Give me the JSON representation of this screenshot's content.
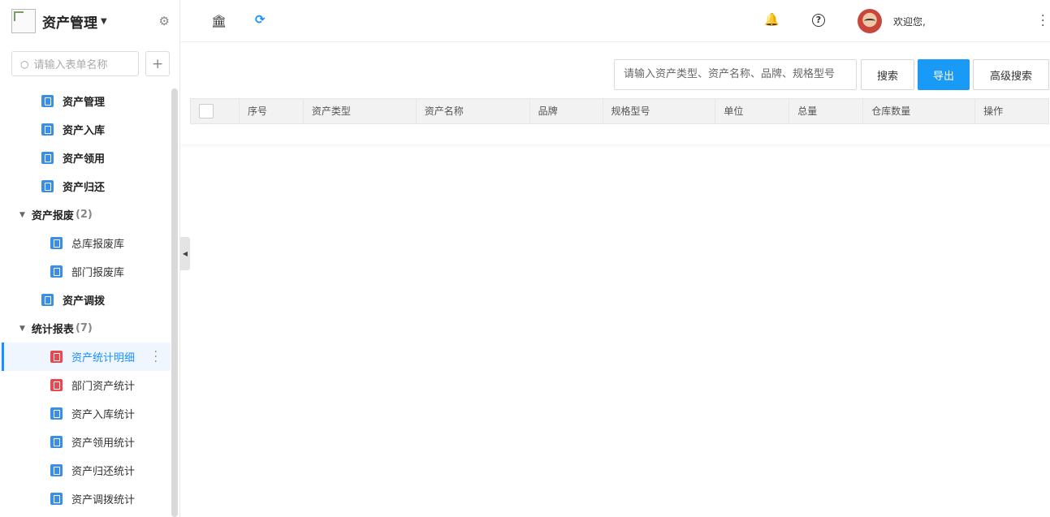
{
  "sidebar": {
    "app_title": "资产管理",
    "search_placeholder": "请输入表单名称",
    "items": [
      {
        "label": "资产管理",
        "type": "item",
        "color": "blue"
      },
      {
        "label": "资产入库",
        "type": "item",
        "color": "blue"
      },
      {
        "label": "资产领用",
        "type": "item",
        "color": "blue"
      },
      {
        "label": "资产归还",
        "type": "item",
        "color": "blue"
      },
      {
        "label": "资产报废",
        "type": "group",
        "count": "(2)"
      },
      {
        "label": "总库报废库",
        "type": "child",
        "color": "blue"
      },
      {
        "label": "部门报废库",
        "type": "child",
        "color": "blue"
      },
      {
        "label": "资产调拨",
        "type": "item",
        "color": "blue"
      },
      {
        "label": "统计报表",
        "type": "group",
        "count": "(7)"
      },
      {
        "label": "资产统计明细",
        "type": "child",
        "color": "red",
        "active": true
      },
      {
        "label": "部门资产统计",
        "type": "child",
        "color": "red"
      },
      {
        "label": "资产入库统计",
        "type": "child",
        "color": "blue"
      },
      {
        "label": "资产领用统计",
        "type": "child",
        "color": "blue"
      },
      {
        "label": "资产归还统计",
        "type": "child",
        "color": "blue"
      },
      {
        "label": "资产调拨统计",
        "type": "child",
        "color": "blue"
      }
    ]
  },
  "header": {
    "welcome": "欢迎您,"
  },
  "toolbar": {
    "query_placeholder": "请输入资产类型、资产名称、品牌、规格型号",
    "search_label": "搜索",
    "export_label": "导出",
    "advanced_label": "高级搜索"
  },
  "table": {
    "columns": [
      "序号",
      "资产类型",
      "资产名称",
      "品牌",
      "规格型号",
      "单位",
      "总量",
      "仓库数量",
      "操作"
    ]
  },
  "colors": {
    "accent": "#1890ff",
    "export_button": "#1a9af7",
    "icon_blue": "#3a8ee6",
    "icon_red": "#e8484f"
  }
}
